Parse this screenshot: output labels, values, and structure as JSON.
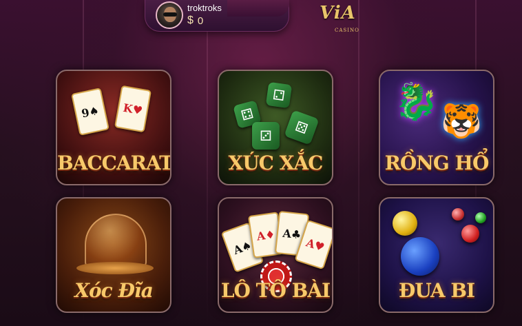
{
  "header": {
    "username": "troktroks",
    "currency_symbol": "$",
    "balance": "0"
  },
  "logo": {
    "text": "ViA",
    "subtext": "CASINO"
  },
  "games": [
    {
      "label": "BACCARAT"
    },
    {
      "label": "XÚC XẮC"
    },
    {
      "label": "RỒNG HỔ"
    },
    {
      "label": "Xóc Đĩa"
    },
    {
      "label": "LÔ TÔ BÀI"
    },
    {
      "label": "ĐUA BI"
    }
  ],
  "colors": {
    "label_gold": "#f7c96a",
    "header_bg": "#4a1d44",
    "page_bg": "#26101f"
  }
}
